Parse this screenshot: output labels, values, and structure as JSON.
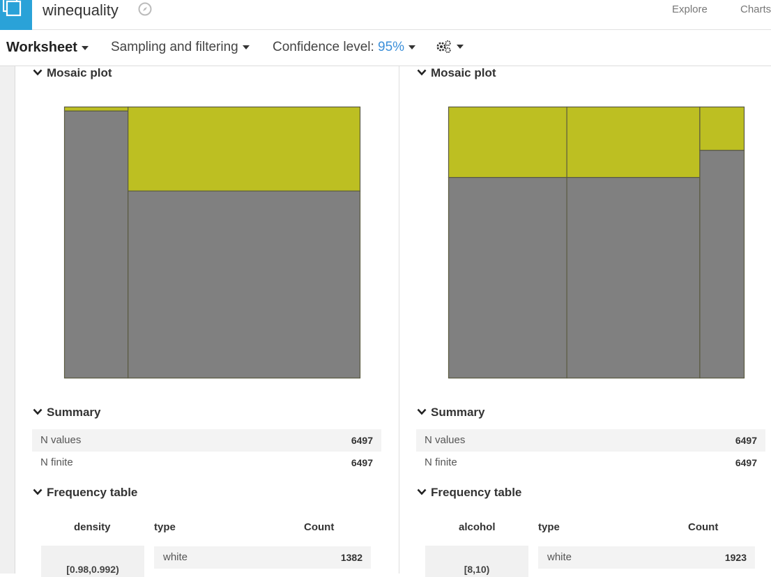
{
  "header": {
    "dataset_name": "winequality",
    "nav": [
      "Explore",
      "Charts"
    ]
  },
  "toolbar": {
    "worksheet_label": "Worksheet",
    "sampling_label": "Sampling and filtering",
    "confidence_label": "Confidence level:",
    "confidence_value": "95%"
  },
  "colors": {
    "accent": "#2aa2d8",
    "mosaic_yellow": "#bdbf22",
    "mosaic_grey": "#808080",
    "link_blue": "#3b8fd9"
  },
  "icons": [
    "dataset-icon",
    "compass-icon",
    "gear-icon",
    "chevron-down-icon"
  ],
  "left_card": {
    "mosaic_title": "Mosaic plot",
    "summary_title": "Summary",
    "summary": [
      {
        "label": "N values",
        "value": "6497"
      },
      {
        "label": "N finite",
        "value": "6497"
      }
    ],
    "freq_title": "Frequency table",
    "freq_headers": [
      "density",
      "type",
      "Count"
    ],
    "freq_rows": [
      {
        "bin": "[0.98,0.992)",
        "type": "white",
        "count": "1382"
      }
    ]
  },
  "right_card": {
    "mosaic_title": "Mosaic plot",
    "summary_title": "Summary",
    "summary": [
      {
        "label": "N values",
        "value": "6497"
      },
      {
        "label": "N finite",
        "value": "6497"
      }
    ],
    "freq_title": "Frequency table",
    "freq_headers": [
      "alcohol",
      "type",
      "Count"
    ],
    "freq_rows": [
      {
        "bin": "[8,10)",
        "type": "white",
        "count": "1923"
      }
    ]
  },
  "chart_data": [
    {
      "type": "mosaic",
      "columns": [
        {
          "width_fraction": 0.215,
          "top_fraction": 0.015
        },
        {
          "width_fraction": 0.785,
          "top_fraction": 0.31
        }
      ]
    },
    {
      "type": "mosaic",
      "columns": [
        {
          "width_fraction": 0.4,
          "top_fraction": 0.26
        },
        {
          "width_fraction": 0.45,
          "top_fraction": 0.26
        },
        {
          "width_fraction": 0.15,
          "top_fraction": 0.16
        }
      ]
    }
  ]
}
